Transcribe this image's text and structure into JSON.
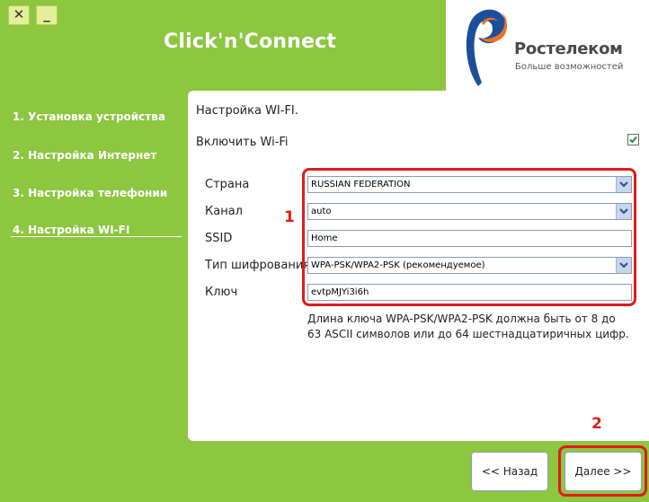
{
  "window": {
    "close_glyph": "✕",
    "minimize_glyph": "_",
    "title": "Click'n'Connect"
  },
  "brand": {
    "name": "Ростелеком",
    "slogan": "Больше возможностей",
    "colors": {
      "orange": "#f37021",
      "blue": "#1b4f9c",
      "green": "#8dc63f"
    }
  },
  "sidebar": {
    "items": [
      {
        "label": "1. Установка устройства",
        "active": false
      },
      {
        "label": "2. Настройка Интернет",
        "active": false
      },
      {
        "label": "3. Настройка телефонии",
        "active": false
      },
      {
        "label": "4. Настройка WI-FI",
        "active": true
      }
    ]
  },
  "panel": {
    "title": "Настройка WI-FI.",
    "enable_label": "Включить Wi-Fi",
    "enable_checked": true,
    "fields": {
      "country": {
        "label": "Страна",
        "value": "RUSSIAN FEDERATION"
      },
      "channel": {
        "label": "Канал",
        "value": "auto"
      },
      "ssid": {
        "label": "SSID",
        "value": "Home"
      },
      "cipher": {
        "label": "Тип шифрования",
        "value": "WPA-PSK/WPA2-PSK (рекомендуемое)"
      },
      "key": {
        "label": "Ключ",
        "value": "evtpMJYi3i6h"
      }
    },
    "hint": "Длина ключа WPA-PSK/WPA2-PSK должна быть от 8 до 63 ASCII символов или до 64 шестнадцатиричных цифр."
  },
  "annotations": {
    "marker_1": "1",
    "marker_2": "2",
    "color": "#e01c1c"
  },
  "buttons": {
    "back": "<< Назад",
    "next": "Далее >>"
  }
}
